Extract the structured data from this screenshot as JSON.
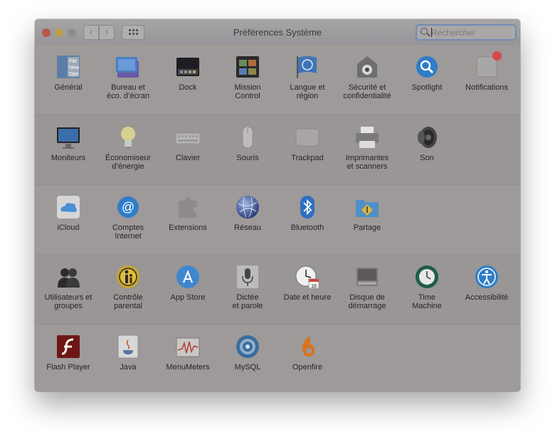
{
  "window": {
    "title": "Préférences Système"
  },
  "search": {
    "placeholder": "Rechercher"
  },
  "rows": [
    [
      {
        "label": "Général",
        "icon": "general-icon"
      },
      {
        "label": "Bureau et\néco. d’écran",
        "icon": "desktop-screensaver-icon"
      },
      {
        "label": "Dock",
        "icon": "dock-icon"
      },
      {
        "label": "Mission\nControl",
        "icon": "mission-control-icon"
      },
      {
        "label": "Langue et\nrégion",
        "icon": "language-region-icon"
      },
      {
        "label": "Sécurité et\nconfidentialité",
        "icon": "security-icon"
      },
      {
        "label": "Spotlight",
        "icon": "spotlight-icon"
      },
      {
        "label": "Notifications",
        "icon": "notifications-icon"
      }
    ],
    [
      {
        "label": "Moniteurs",
        "icon": "displays-icon"
      },
      {
        "label": "Économiseur\nd’énergie",
        "icon": "energy-saver-icon"
      },
      {
        "label": "Clavier",
        "icon": "keyboard-icon"
      },
      {
        "label": "Souris",
        "icon": "mouse-icon"
      },
      {
        "label": "Trackpad",
        "icon": "trackpad-icon"
      },
      {
        "label": "Imprimantes\net scanners",
        "icon": "printers-icon"
      },
      {
        "label": "Son",
        "icon": "sound-icon"
      }
    ],
    [
      {
        "label": "iCloud",
        "icon": "icloud-icon"
      },
      {
        "label": "Comptes\nInternet",
        "icon": "internet-accounts-icon"
      },
      {
        "label": "Extensions",
        "icon": "extensions-icon"
      },
      {
        "label": "Réseau",
        "icon": "network-icon"
      },
      {
        "label": "Bluetooth",
        "icon": "bluetooth-icon"
      },
      {
        "label": "Partage",
        "icon": "sharing-icon"
      }
    ],
    [
      {
        "label": "Utilisateurs et\ngroupes",
        "icon": "users-groups-icon"
      },
      {
        "label": "Contrôle\nparental",
        "icon": "parental-controls-icon"
      },
      {
        "label": "App Store",
        "icon": "app-store-icon"
      },
      {
        "label": "Dictée\net parole",
        "icon": "dictation-icon"
      },
      {
        "label": "Date et heure",
        "icon": "date-time-icon"
      },
      {
        "label": "Disque de\ndémarrage",
        "icon": "startup-disk-icon"
      },
      {
        "label": "Time\nMachine",
        "icon": "time-machine-icon"
      },
      {
        "label": "Accessibilité",
        "icon": "accessibility-icon"
      }
    ],
    [
      {
        "label": "Flash Player",
        "icon": "flash-player-icon"
      },
      {
        "label": "Java",
        "icon": "java-icon"
      },
      {
        "label": "MenuMeters",
        "icon": "menumeters-icon"
      },
      {
        "label": "MySQL",
        "icon": "mysql-icon"
      },
      {
        "label": "Openfire",
        "icon": "openfire-icon"
      }
    ]
  ],
  "file_icon_text": [
    "File",
    "New",
    "Ope"
  ],
  "calendar_day": "18"
}
